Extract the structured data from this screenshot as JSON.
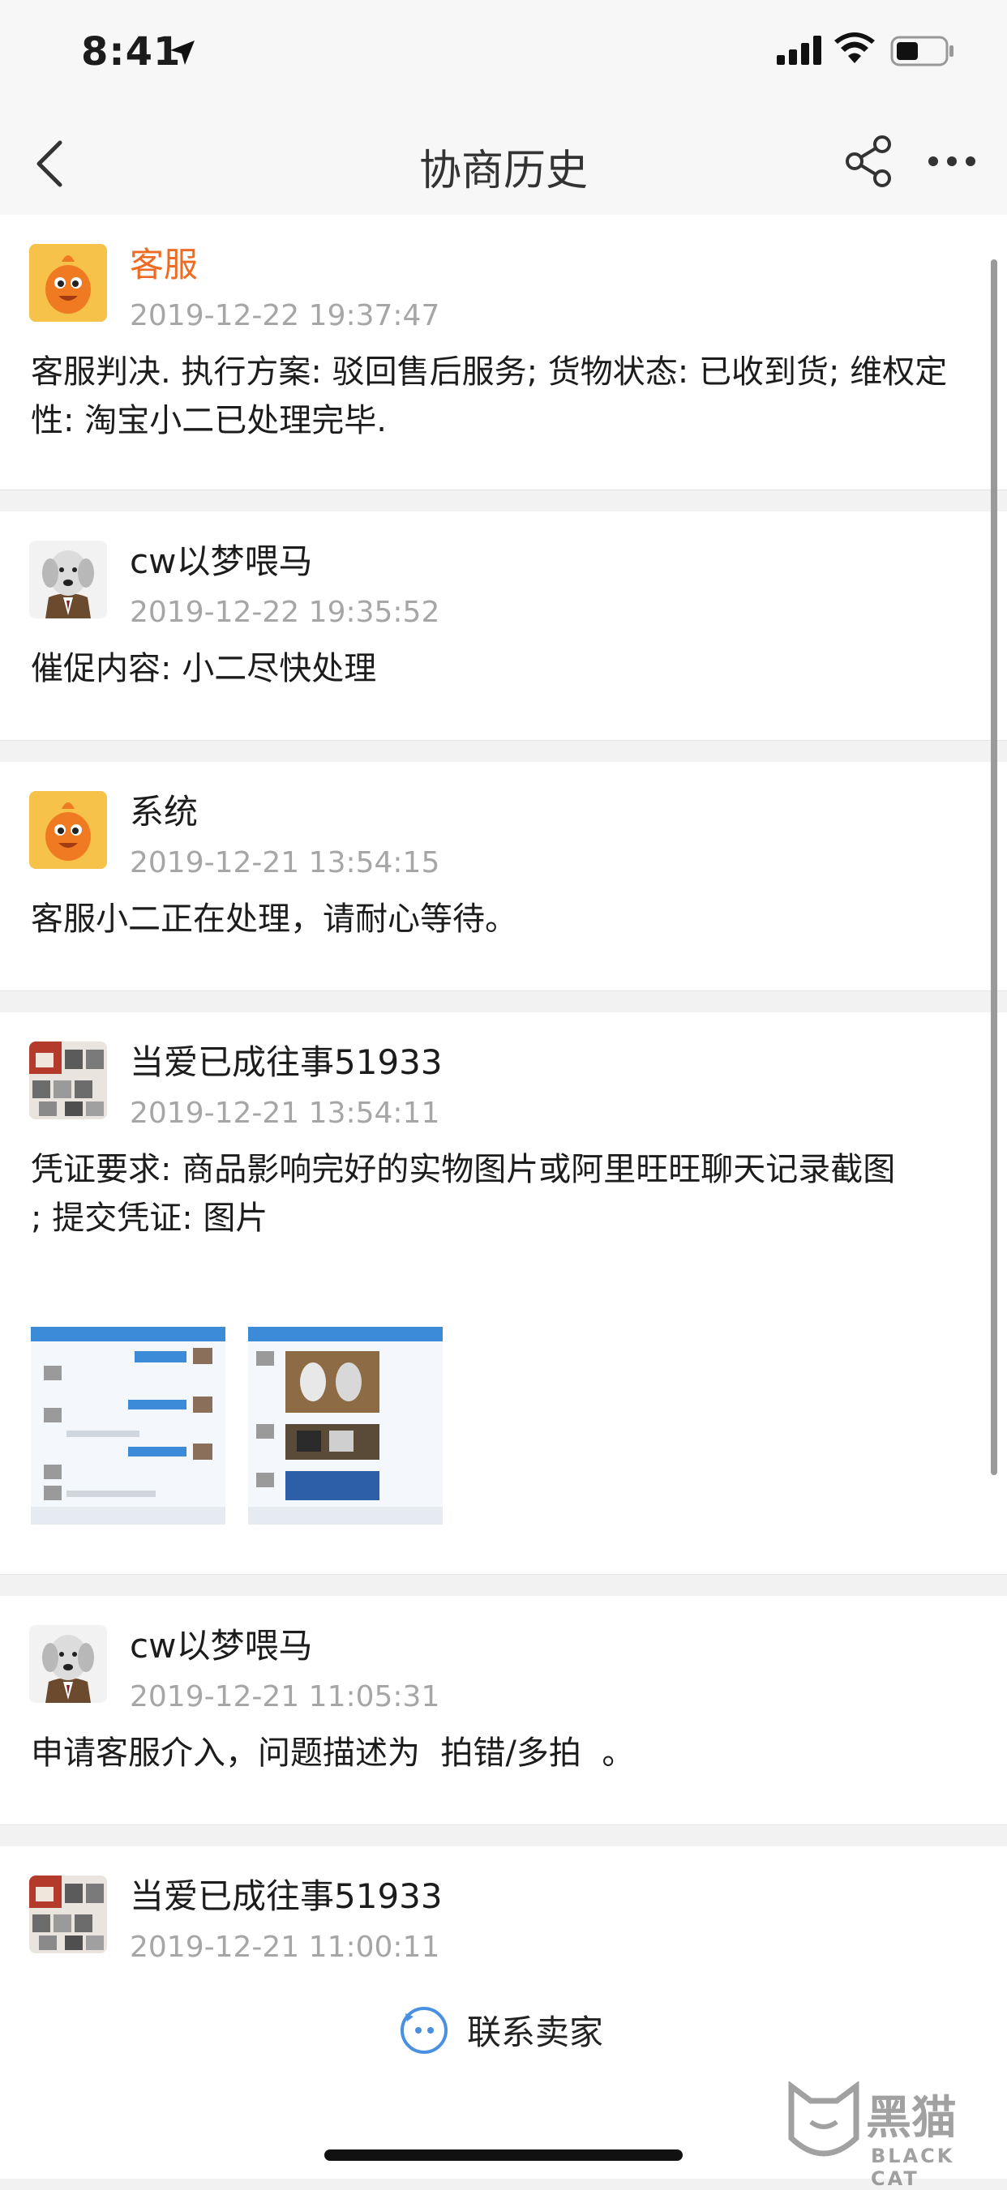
{
  "status_bar": {
    "time": "8:41"
  },
  "nav": {
    "title": "协商历史"
  },
  "records": [
    {
      "name": "客服",
      "time": "2019-12-22 19:37:47",
      "text": "客服判决. 执行方案: 驳回售后服务; 货物状态: 已收到货; 维权定性: 淘宝小二已处理完毕.",
      "avatar": "taobao-mascot-avatar",
      "name_color": "#ef6a22"
    },
    {
      "name": "cw以梦喂马",
      "time": "2019-12-22 19:35:52",
      "text": "催促内容: 小二尽快处理",
      "avatar": "dog-avatar"
    },
    {
      "name": "系统",
      "time": "2019-12-21 13:54:15",
      "text": "客服小二正在处理，请耐心等待。",
      "avatar": "taobao-mascot-avatar"
    },
    {
      "name": "当爱已成往事51933",
      "time": "2019-12-21 13:54:11",
      "text": "凭证要求: 商品影响完好的实物图片或阿里旺旺聊天记录截图\n; 提交凭证: 图片",
      "avatar": "shop-avatar"
    },
    {
      "name": "cw以梦喂马",
      "time": "2019-12-21 11:05:31",
      "text": "申请客服介入，问题描述为  拍错/多拍  。",
      "avatar": "dog-avatar"
    },
    {
      "name": "当爱已成往事51933",
      "time": "2019-12-21 11:00:11",
      "avatar": "shop-avatar"
    }
  ],
  "bottom": {
    "contact_label": "联系卖家"
  },
  "watermark": {
    "cn": "黑猫",
    "en": "BLACK CAT"
  },
  "colors": {
    "accent_orange": "#ef6a22",
    "timestamp_gray": "#a6a6a6",
    "contact_blue": "#4a90e2"
  }
}
